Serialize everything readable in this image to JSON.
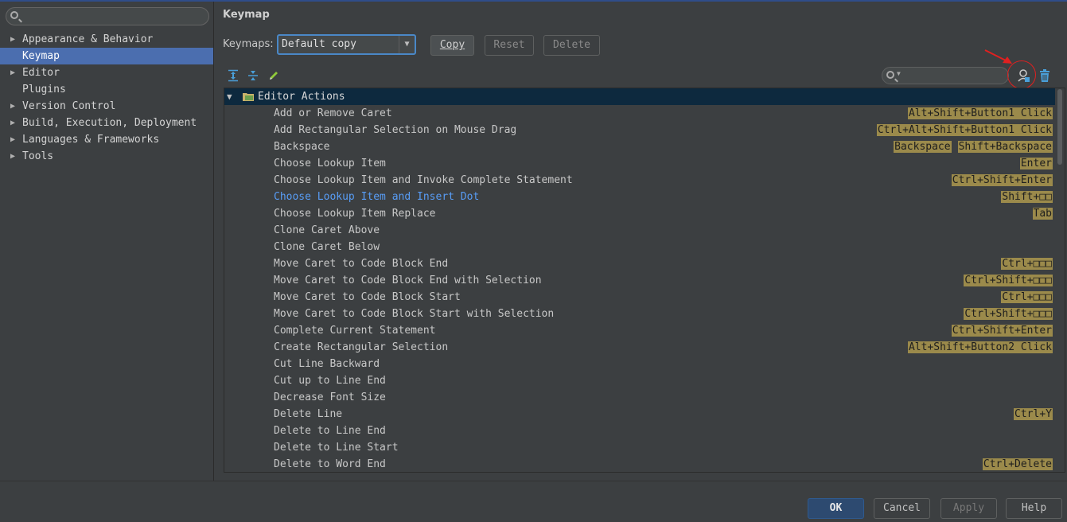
{
  "sidebar": {
    "items": [
      {
        "label": "Appearance & Behavior",
        "expandable": true
      },
      {
        "label": "Keymap",
        "expandable": false,
        "selected": true
      },
      {
        "label": "Editor",
        "expandable": true
      },
      {
        "label": "Plugins",
        "expandable": false
      },
      {
        "label": "Version Control",
        "expandable": true
      },
      {
        "label": "Build, Execution, Deployment",
        "expandable": true
      },
      {
        "label": "Languages & Frameworks",
        "expandable": true
      },
      {
        "label": "Tools",
        "expandable": true
      }
    ]
  },
  "main": {
    "title": "Keymap",
    "keymaps_label": "Keymaps:",
    "keymaps_value": "Default copy",
    "copy_label": "Copy",
    "reset_label": "Reset",
    "delete_label": "Delete"
  },
  "tree": {
    "header": "Editor Actions",
    "rows": [
      {
        "label": "Add or Remove Caret",
        "keys": [
          "Alt+Shift+Button1 Click"
        ]
      },
      {
        "label": "Add Rectangular Selection on Mouse Drag",
        "keys": [
          "Ctrl+Alt+Shift+Button1 Click"
        ]
      },
      {
        "label": "Backspace",
        "keys": [
          "Backspace",
          "Shift+Backspace"
        ]
      },
      {
        "label": "Choose Lookup Item",
        "keys": [
          "Enter"
        ]
      },
      {
        "label": "Choose Lookup Item and Invoke Complete Statement",
        "keys": [
          "Ctrl+Shift+Enter"
        ]
      },
      {
        "label": "Choose Lookup Item and Insert Dot",
        "keys": [
          "Shift+□□"
        ],
        "highlight": true
      },
      {
        "label": "Choose Lookup Item Replace",
        "keys": [
          "Tab"
        ]
      },
      {
        "label": "Clone Caret Above",
        "keys": []
      },
      {
        "label": "Clone Caret Below",
        "keys": []
      },
      {
        "label": "Move Caret to Code Block End",
        "keys": [
          "Ctrl+□□□"
        ]
      },
      {
        "label": "Move Caret to Code Block End with Selection",
        "keys": [
          "Ctrl+Shift+□□□"
        ]
      },
      {
        "label": "Move Caret to Code Block Start",
        "keys": [
          "Ctrl+□□□"
        ]
      },
      {
        "label": "Move Caret to Code Block Start with Selection",
        "keys": [
          "Ctrl+Shift+□□□"
        ]
      },
      {
        "label": "Complete Current Statement",
        "keys": [
          "Ctrl+Shift+Enter"
        ]
      },
      {
        "label": "Create Rectangular Selection",
        "keys": [
          "Alt+Shift+Button2 Click"
        ]
      },
      {
        "label": "Cut Line Backward",
        "keys": []
      },
      {
        "label": "Cut up to Line End",
        "keys": []
      },
      {
        "label": "Decrease Font Size",
        "keys": []
      },
      {
        "label": "Delete Line",
        "keys": [
          "Ctrl+Y"
        ]
      },
      {
        "label": "Delete to Line End",
        "keys": []
      },
      {
        "label": "Delete to Line Start",
        "keys": []
      },
      {
        "label": "Delete to Word End",
        "keys": [
          "Ctrl+Delete"
        ]
      }
    ]
  },
  "footer": {
    "ok": "OK",
    "cancel": "Cancel",
    "apply": "Apply",
    "help": "Help"
  },
  "colors": {
    "accent": "#4b6eaf",
    "shortcut_bg": "#9b8a4b",
    "link": "#589df6",
    "annotation": "#e02020"
  },
  "icons": [
    "search-icon",
    "expand-all-icon",
    "collapse-all-icon",
    "edit-icon",
    "find-shortcut-icon",
    "trash-icon",
    "folder-icon"
  ]
}
